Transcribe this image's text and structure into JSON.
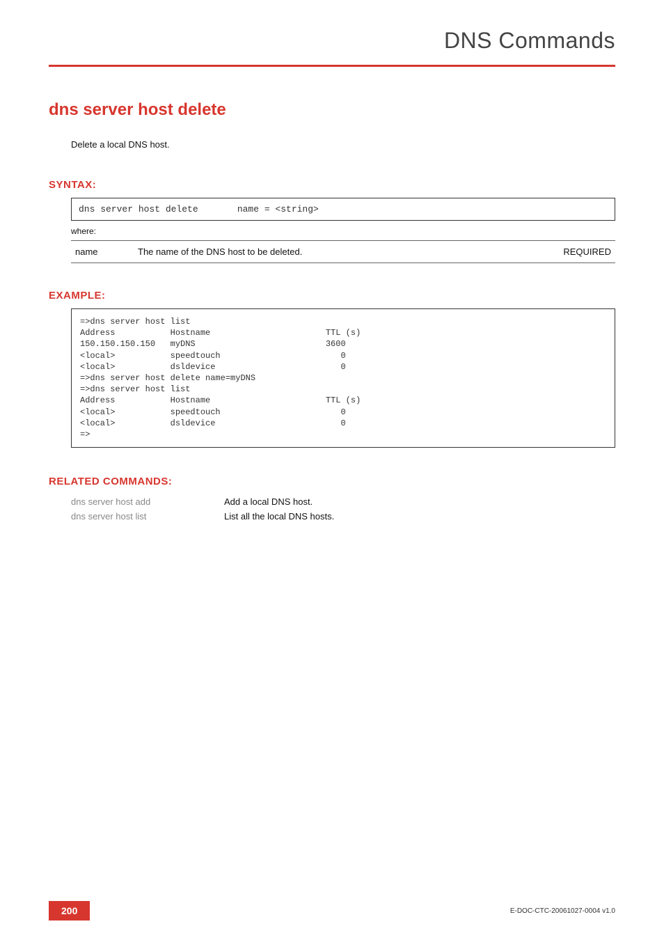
{
  "chapter_title": "DNS Commands",
  "command_title": "dns server host delete",
  "description": "Delete a local DNS host.",
  "syntax": {
    "heading": "SYNTAX:",
    "command": "dns server host delete",
    "args": "name = <string>",
    "where_label": "where:",
    "params": [
      {
        "name": "name",
        "desc": "The name of the DNS host to be deleted.",
        "req": "REQUIRED"
      }
    ]
  },
  "example": {
    "heading": "EXAMPLE:",
    "text": "=>dns server host list\nAddress           Hostname                       TTL (s)\n150.150.150.150   myDNS                          3600\n<local>           speedtouch                        0\n<local>           dsldevice                         0\n=>dns server host delete name=myDNS\n=>dns server host list\nAddress           Hostname                       TTL (s)\n<local>           speedtouch                        0\n<local>           dsldevice                         0\n=>"
  },
  "related": {
    "heading": "RELATED COMMANDS:",
    "items": [
      {
        "name": "dns server host add",
        "desc": "Add a local DNS host."
      },
      {
        "name": "dns server host list",
        "desc": "List all the local DNS hosts."
      }
    ]
  },
  "footer": {
    "page_number": "200",
    "doc_id": "E-DOC-CTC-20061027-0004 v1.0"
  }
}
